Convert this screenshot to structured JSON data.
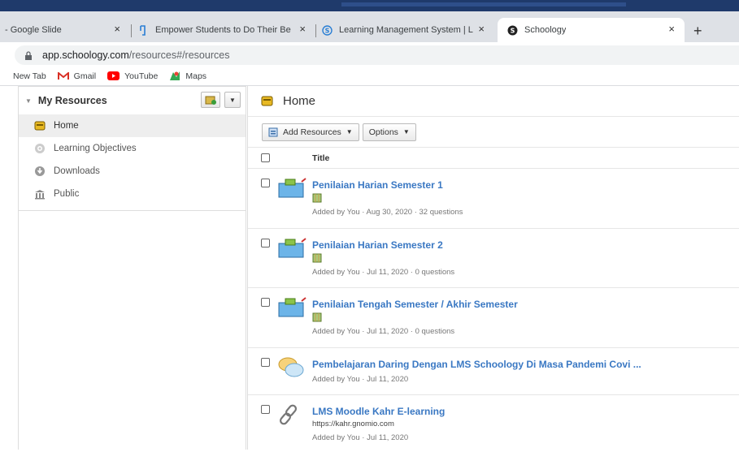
{
  "browser": {
    "tabs": [
      {
        "label": "- Google Slide"
      },
      {
        "label": "Empower Students to Do Their Be"
      },
      {
        "label": "Learning Management System | L"
      },
      {
        "label": "Schoology"
      }
    ],
    "close_glyph": "×",
    "new_tab_glyph": "+",
    "url_host": "app.schoology.com",
    "url_path": "/resources#/resources",
    "bookmarks": [
      "New Tab",
      "Gmail",
      "YouTube",
      "Maps"
    ]
  },
  "sidebar": {
    "title": "My Resources",
    "items": [
      {
        "label": "Home",
        "icon": "home-folder-icon"
      },
      {
        "label": "Learning Objectives",
        "icon": "target-icon"
      },
      {
        "label": "Downloads",
        "icon": "download-icon"
      },
      {
        "label": "Public",
        "icon": "public-building-icon"
      }
    ]
  },
  "main": {
    "title": "Home",
    "toolbar": {
      "add_resources": "Add Resources",
      "options": "Options"
    },
    "column_title": "Title",
    "rows": [
      {
        "title": "Penilaian Harian Semester 1",
        "meta": "Added by You · Aug 30, 2020 · 32 questions",
        "type": "question-bank-icon"
      },
      {
        "title": "Penilaian Harian Semester 2",
        "meta": "Added by You · Jul 11, 2020 · 0 questions",
        "type": "question-bank-icon"
      },
      {
        "title": "Penilaian Tengah Semester / Akhir Semester",
        "meta": "Added by You · Jul 11, 2020 · 0 questions",
        "type": "question-bank-icon"
      },
      {
        "title": "Pembelajaran Daring Dengan LMS Schoology Di Masa Pandemi Covi ...",
        "meta": "Added by You · Jul 11, 2020",
        "type": "discussion-icon"
      },
      {
        "title": "LMS Moodle Kahr E-learning",
        "url": "https://kahr.gnomio.com",
        "meta": "Added by You · Jul 11, 2020",
        "type": "link-icon"
      }
    ]
  },
  "colors": {
    "link": "#3a78c3",
    "chrome_tabbar": "#dee1e6",
    "chrome_top": "#1f3a6b"
  }
}
